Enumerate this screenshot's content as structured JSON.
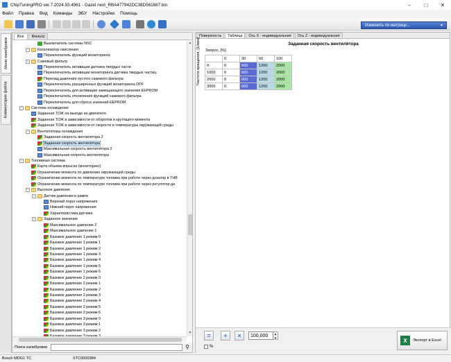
{
  "window": {
    "title": "ChipTuningPRO ver.7.2024.93.4961 - Gazel next_RBA477942DC38D561687.bin"
  },
  "menu": [
    "Файл",
    "Правка",
    "Вид",
    "Команды",
    "ЭБУ",
    "Настройки",
    "Помощь"
  ],
  "toolbar": {
    "matrix_button": "Изменить по матрице..."
  },
  "side_tabs": [
    "Меню калибровок",
    "Комментарии файла"
  ],
  "left_tabs": [
    "Все",
    "Фильтр"
  ],
  "tree": [
    {
      "level": 3,
      "icon": "check",
      "label": "Выключатель системы NSC"
    },
    {
      "level": 2,
      "icon": "folder",
      "exp": "-",
      "label": "Катализатор окисления"
    },
    {
      "level": 3,
      "icon": "table",
      "label": "Переключатель функций мониторинга"
    },
    {
      "level": 2,
      "icon": "folder",
      "exp": "-",
      "label": "Сажевый фильтр"
    },
    {
      "level": 3,
      "icon": "table",
      "label": "Переключатель активации датчика твердых части"
    },
    {
      "level": 3,
      "icon": "table",
      "label": "Переключатель активации мониторинга датчика твердых частиц"
    },
    {
      "level": 3,
      "icon": "map",
      "label": "Перепад давления пустого сажевого фильтра"
    },
    {
      "level": 3,
      "icon": "table",
      "label": "Переключатель расширенных функций мониторинга DPF"
    },
    {
      "level": 3,
      "icon": "table",
      "label": "Переключатель для активации замещающего значения EEPROM"
    },
    {
      "level": 3,
      "icon": "table",
      "label": "Переключатель отключения функций сажевого фильтра"
    },
    {
      "level": 3,
      "icon": "table",
      "label": "Переключатель для сброса значений EEPROM"
    },
    {
      "level": 1,
      "icon": "folder",
      "exp": "-",
      "label": "Система охлаждения"
    },
    {
      "level": 2,
      "icon": "table",
      "label": "Заданная ТОЖ на выходе из двигателя"
    },
    {
      "level": 2,
      "icon": "map",
      "label": "Заданная ТОЖ в зависимости от оборотов и крутящего момента"
    },
    {
      "level": 2,
      "icon": "map",
      "label": "Заданная ТОЖ в зависимости от скорости и температуры окружающей среды"
    },
    {
      "level": 2,
      "icon": "folder",
      "exp": "-",
      "label": "Вентиляторы охлаждения"
    },
    {
      "level": 3,
      "icon": "map",
      "label": "Заданная скорость вентилятора 2"
    },
    {
      "level": 3,
      "icon": "map",
      "label": "Заданная скорость вентилятора",
      "selected": true
    },
    {
      "level": 3,
      "icon": "table",
      "label": "Максимальная скорость вентилятора 2"
    },
    {
      "level": 3,
      "icon": "table",
      "label": "Максимальная скорость вентилятора"
    },
    {
      "level": 1,
      "icon": "folder",
      "exp": "-",
      "label": "Топливная система"
    },
    {
      "level": 2,
      "icon": "map",
      "label": "Карта объема впрыска (мониторинг)"
    },
    {
      "level": 2,
      "icon": "map",
      "label": "Ограничение момента по давлению окружающей среды"
    },
    {
      "level": 2,
      "icon": "map",
      "label": "Ограничение момента по температуре топлива при работе через дозатор в ТНВ"
    },
    {
      "level": 2,
      "icon": "map",
      "label": "Ограничение момента по температуре топлива при работе через регулятор да"
    },
    {
      "level": 2,
      "icon": "folder",
      "exp": "-",
      "label": "Высокое давление"
    },
    {
      "level": 3,
      "icon": "folder",
      "exp": "-",
      "label": "Датчик давления в рампе"
    },
    {
      "level": 4,
      "icon": "table",
      "label": "Верхний порог напряжения"
    },
    {
      "level": 4,
      "icon": "table",
      "label": "Нижний порог напряжения"
    },
    {
      "level": 4,
      "icon": "map",
      "label": "Характеристика датчика"
    },
    {
      "level": 3,
      "icon": "folder",
      "exp": "-",
      "label": "Заданное значение"
    },
    {
      "level": 4,
      "icon": "map",
      "label": "Максимальное давление 2"
    },
    {
      "level": 4,
      "icon": "map",
      "label": "Максимальное давление 1"
    },
    {
      "level": 4,
      "icon": "map",
      "label": "Базовое давление 1 режим 0"
    },
    {
      "level": 4,
      "icon": "map",
      "label": "Базовое давление 1 режим 1"
    },
    {
      "level": 4,
      "icon": "map",
      "label": "Базовое давление 1 режим 2"
    },
    {
      "level": 4,
      "icon": "map",
      "label": "Базовое давление 1 режим 3"
    },
    {
      "level": 4,
      "icon": "map",
      "label": "Базовое давление 1 режим 4"
    },
    {
      "level": 4,
      "icon": "map",
      "label": "Базовое давление 1 режим 5"
    },
    {
      "level": 4,
      "icon": "map",
      "label": "Базовое давление 1 режим 6"
    },
    {
      "level": 4,
      "icon": "map",
      "label": "Базовое давление 2 режим 0"
    },
    {
      "level": 4,
      "icon": "map",
      "label": "Базовое давление 2 режим 1"
    },
    {
      "level": 4,
      "icon": "map",
      "label": "Базовое давление 2 режим 2"
    },
    {
      "level": 4,
      "icon": "map",
      "label": "Базовое давление 2 режим 3"
    },
    {
      "level": 4,
      "icon": "map",
      "label": "Базовое давление 2 режим 4"
    },
    {
      "level": 4,
      "icon": "map",
      "label": "Базовое давление 2 режим 5"
    },
    {
      "level": 4,
      "icon": "map",
      "label": "Базовое давление 2 режим 6"
    },
    {
      "level": 4,
      "icon": "map",
      "label": "Базовое давление 3 режим 0"
    },
    {
      "level": 4,
      "icon": "map",
      "label": "Базовое давление 3 режим 1"
    },
    {
      "level": 4,
      "icon": "map",
      "label": "Базовое давление 3 режим 2"
    },
    {
      "level": 4,
      "icon": "map",
      "label": "Базовое давление 3 режим 3"
    }
  ],
  "search": {
    "label": "Поиск калибровки",
    "value": ""
  },
  "right_tabs": [
    "Поверхность",
    "Таблица",
    "Ось X - индивидуальная",
    "Ось Z - индивидуальная"
  ],
  "map": {
    "title": "Заданная скорость вентилятора",
    "x_label": "Запрос, [%]",
    "y_label": "Частота вращения, [1/мин]",
    "x_values": [
      "0",
      "30",
      "60",
      "100"
    ],
    "rows": [
      {
        "y": "0",
        "cells": [
          "0",
          "600",
          "1200",
          "2000"
        ]
      },
      {
        "y": "1000",
        "cells": [
          "0",
          "600",
          "1200",
          "2000"
        ]
      },
      {
        "y": "2000",
        "cells": [
          "0",
          "600",
          "1200",
          "2000"
        ]
      },
      {
        "y": "3000",
        "cells": [
          "0",
          "600",
          "1200",
          "2000"
        ]
      }
    ]
  },
  "edit": {
    "value": "100,000",
    "percent_label": "%",
    "excel_label": "Экспорт в Excel"
  },
  "status": {
    "ecu": "Bosch MDG1 TC",
    "code": "STC0000384"
  },
  "colors": {
    "accent": "#2c58b4",
    "cell_zero": "#5a6ad4",
    "cell_mid": "#b9d9e6",
    "cell_high": "#a8e6a4"
  }
}
